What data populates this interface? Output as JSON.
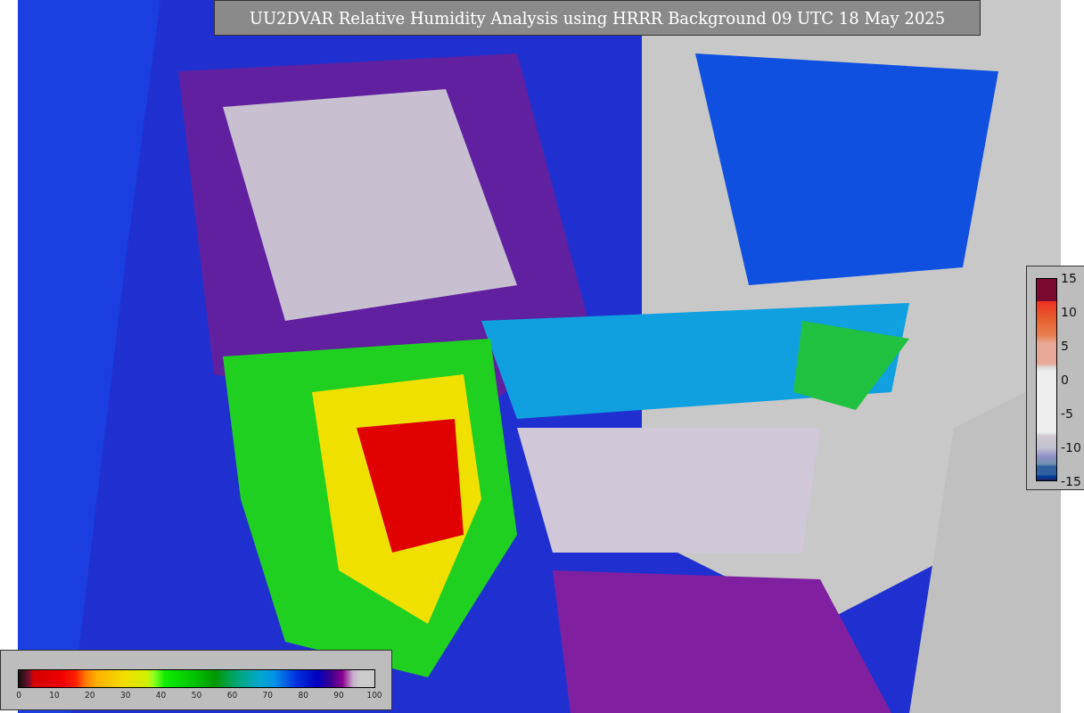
{
  "title": "UU2DVAR Relative Humidity Analysis using HRRR Background 09 UTC 18 May 2025",
  "humidity_legend": {
    "ticks": [
      "0",
      "10",
      "20",
      "30",
      "40",
      "50",
      "60",
      "70",
      "80",
      "90",
      "100"
    ]
  },
  "increment_legend": {
    "ticks": [
      "15",
      "10",
      "5",
      "0",
      "-5",
      "-10",
      "-15"
    ]
  }
}
